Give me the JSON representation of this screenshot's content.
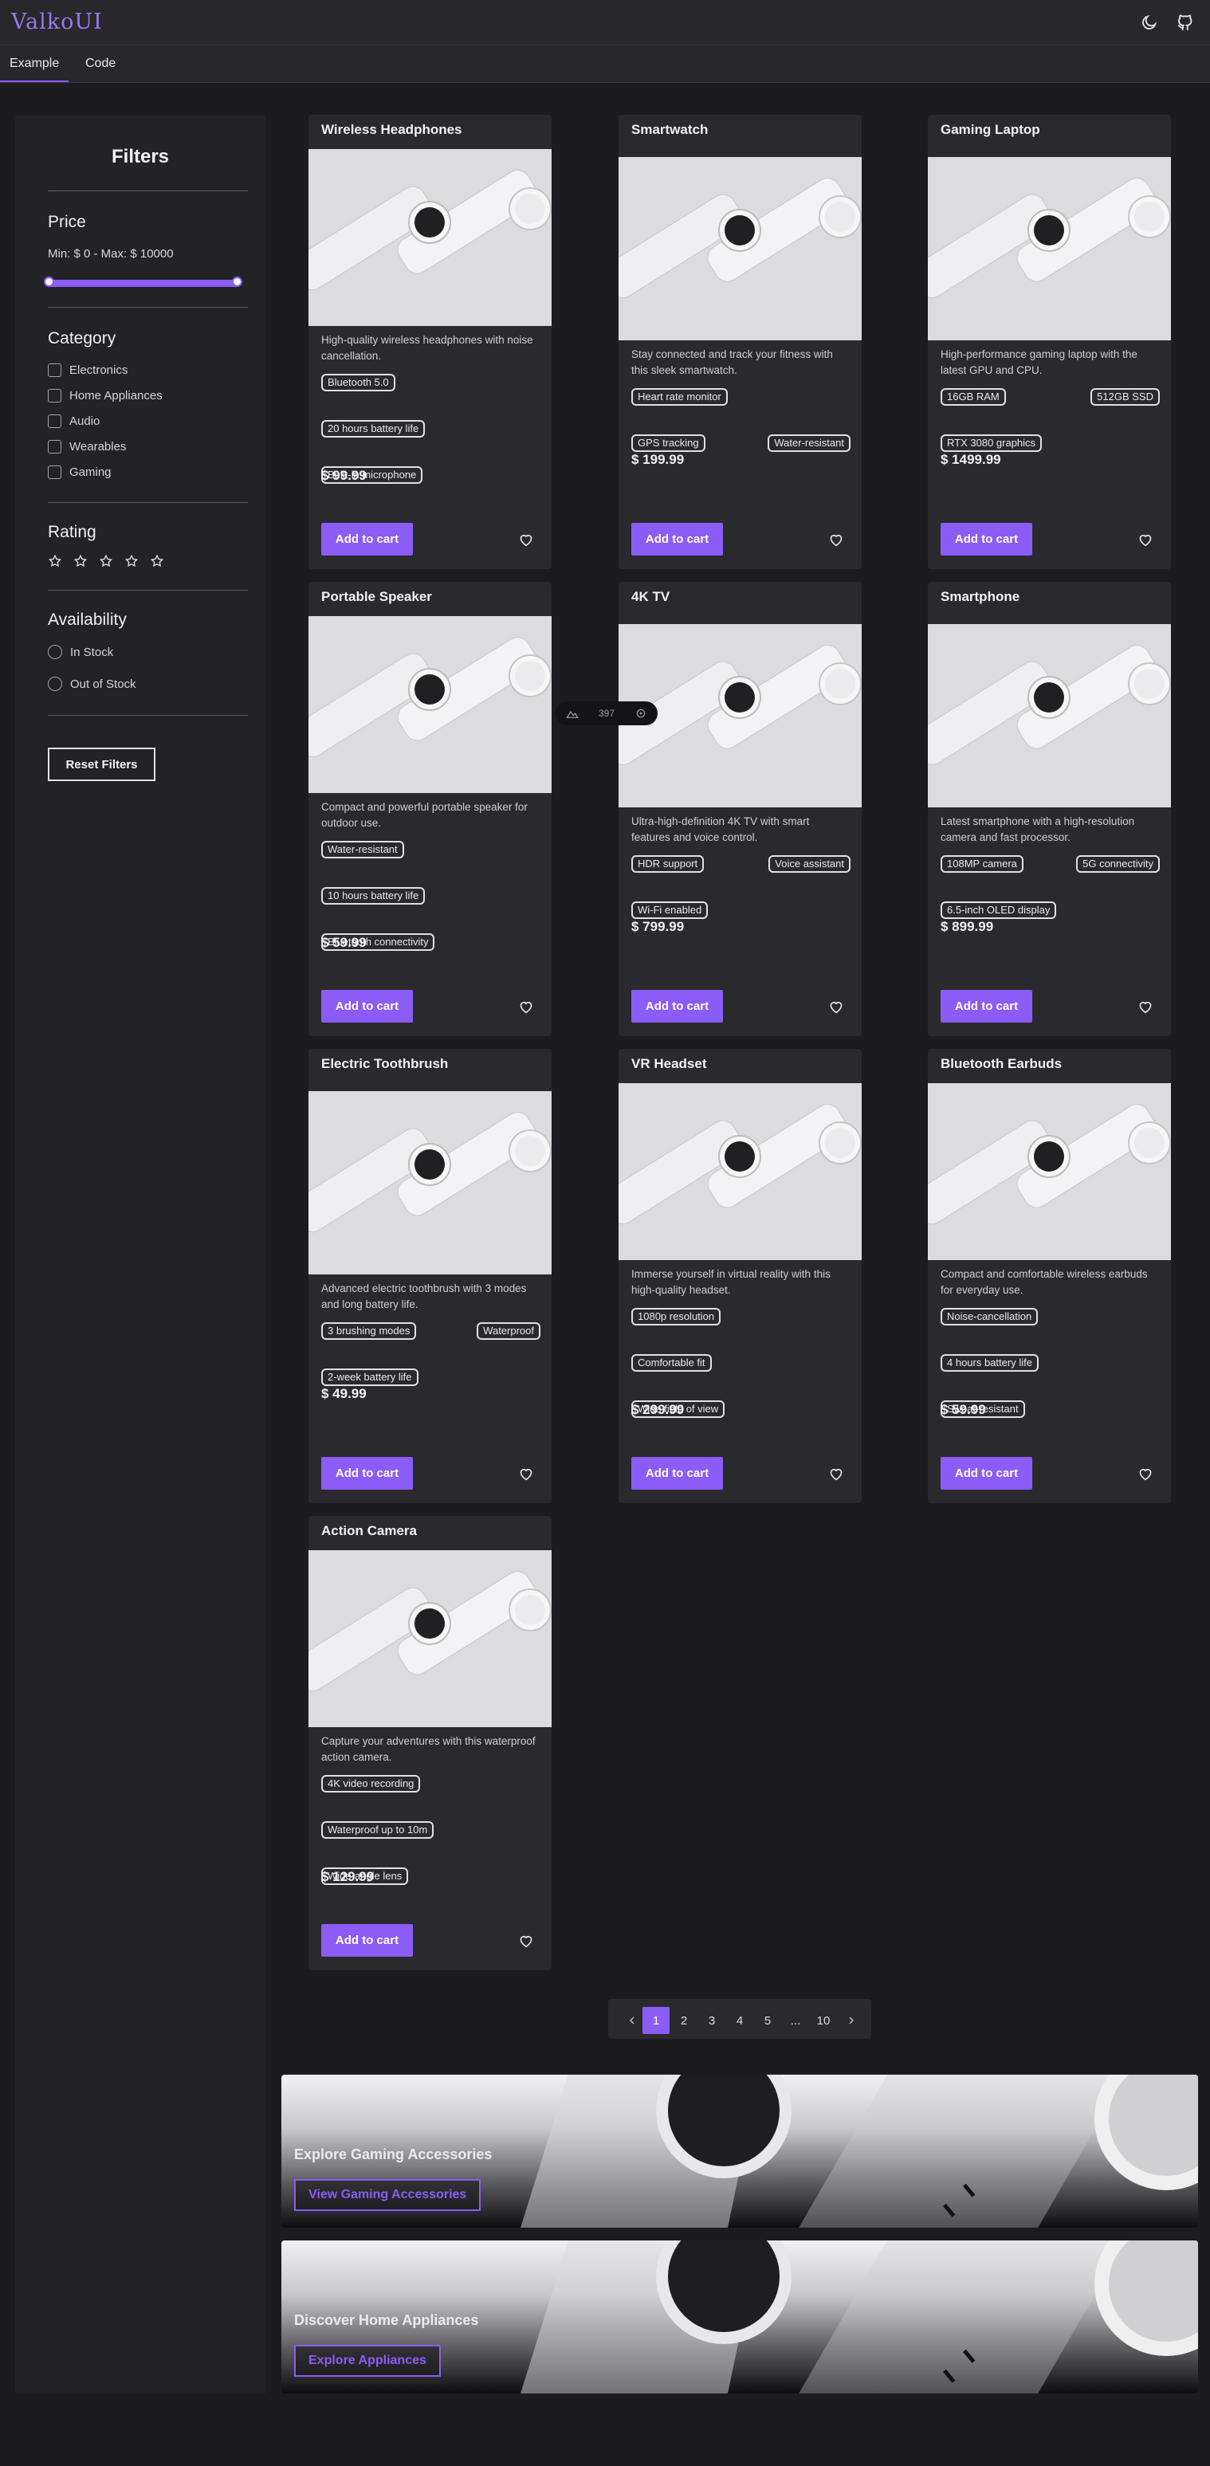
{
  "app": {
    "brand": "ValkoUI"
  },
  "header": {
    "icons": [
      "moon-icon",
      "github-icon"
    ]
  },
  "tabs": [
    {
      "label": "Example",
      "active": true
    },
    {
      "label": "Code",
      "active": false
    }
  ],
  "filters": {
    "title": "Filters",
    "price": {
      "title": "Price",
      "range_text": "Min: $ 0 - Max: $ 10000",
      "min": 0,
      "max": 10000
    },
    "category": {
      "title": "Category",
      "options": [
        "Electronics",
        "Home Appliances",
        "Audio",
        "Wearables",
        "Gaming"
      ]
    },
    "rating": {
      "title": "Rating",
      "stars": 5,
      "selected": 0
    },
    "availability": {
      "title": "Availability",
      "options": [
        "In Stock",
        "Out of Stock"
      ]
    },
    "reset_label": "Reset Filters"
  },
  "products": [
    {
      "title": "Wireless Headphones",
      "desc": "High-quality wireless headphones with noise cancellation.",
      "tags": [
        "Bluetooth 5.0",
        "20 hours battery life",
        "Built-in microphone"
      ],
      "price": "$ 99.99"
    },
    {
      "title": "Smartwatch",
      "desc": "Stay connected and track your fitness with this sleek smartwatch.",
      "tags": [
        "Heart rate monitor",
        "GPS tracking",
        "Water-resistant"
      ],
      "price": "$ 199.99"
    },
    {
      "title": "Gaming Laptop",
      "desc": "High-performance gaming laptop with the latest GPU and CPU.",
      "tags": [
        "16GB RAM",
        "512GB SSD",
        "RTX 3080 graphics"
      ],
      "price": "$ 1499.99"
    },
    {
      "title": "Portable Speaker",
      "desc": "Compact and powerful portable speaker for outdoor use.",
      "tags": [
        "Water-resistant",
        "10 hours battery life",
        "Bluetooth connectivity"
      ],
      "price": "$ 59.99"
    },
    {
      "title": "4K TV",
      "desc": "Ultra-high-definition 4K TV with smart features and voice control.",
      "tags": [
        "HDR support",
        "Voice assistant",
        "Wi-Fi enabled"
      ],
      "price": "$ 799.99"
    },
    {
      "title": "Smartphone",
      "desc": "Latest smartphone with a high-resolution camera and fast processor.",
      "tags": [
        "108MP camera",
        "5G connectivity",
        "6.5-inch OLED display"
      ],
      "price": "$ 899.99"
    },
    {
      "title": "Electric Toothbrush",
      "desc": "Advanced electric toothbrush with 3 modes and long battery life.",
      "tags": [
        "3 brushing modes",
        "Waterproof",
        "2-week battery life"
      ],
      "price": "$ 49.99"
    },
    {
      "title": "VR Headset",
      "desc": "Immerse yourself in virtual reality with this high-quality headset.",
      "tags": [
        "1080p resolution",
        "Comfortable fit",
        "Wide field of view"
      ],
      "price": "$ 299.99"
    },
    {
      "title": "Bluetooth Earbuds",
      "desc": "Compact and comfortable wireless earbuds for everyday use.",
      "tags": [
        "Noise-cancellation",
        "4 hours battery life",
        "Sweat-resistant"
      ],
      "price": "$ 59.99"
    },
    {
      "title": "Action Camera",
      "desc": "Capture your adventures with this waterproof action camera.",
      "tags": [
        "4K video recording",
        "Waterproof up to 10m",
        "Wide-angle lens"
      ],
      "price": "$ 129.99"
    }
  ],
  "cart_label": "Add to cart",
  "floating_pill": {
    "value": "397"
  },
  "pagination": {
    "pages": [
      "1",
      "2",
      "3",
      "4",
      "5",
      "...",
      "10"
    ],
    "current": "1"
  },
  "banners": [
    {
      "title": "Explore Gaming Accessories",
      "button": "View Gaming Accessories"
    },
    {
      "title": "Discover Home Appliances",
      "button": "Explore Appliances"
    }
  ],
  "colors": {
    "accent": "#8b5cf6",
    "background": "#1c1b1f",
    "card": "#2a292e",
    "brand": "#9b79ea"
  }
}
